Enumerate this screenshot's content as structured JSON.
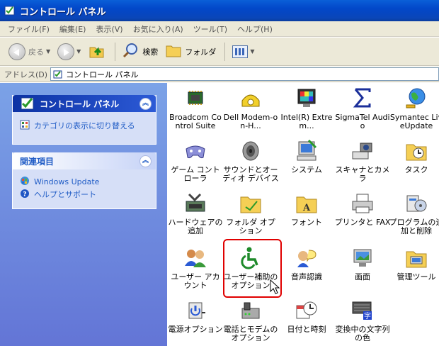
{
  "window": {
    "title": "コントロール パネル"
  },
  "menu": [
    {
      "label": "ファイル(F)"
    },
    {
      "label": "編集(E)"
    },
    {
      "label": "表示(V)"
    },
    {
      "label": "お気に入り(A)"
    },
    {
      "label": "ツール(T)"
    },
    {
      "label": "ヘルプ(H)"
    }
  ],
  "toolbar": {
    "back_label": "戻る",
    "search_label": "検索",
    "folders_label": "フォルダ"
  },
  "address": {
    "label": "アドレス(D)",
    "value": "コントロール パネル"
  },
  "taskpane": {
    "cp_panel": {
      "title": "コントロール パネル",
      "links": [
        {
          "label": "カテゴリの表示に切り替える"
        }
      ]
    },
    "related_panel": {
      "title": "関連項目",
      "links": [
        {
          "label": "Windows Update"
        },
        {
          "label": "ヘルプとサポート"
        }
      ]
    }
  },
  "items": [
    {
      "label": "Broadcom Control Suite",
      "icon": "chip-icon"
    },
    {
      "label": "Dell Modem-on-H...",
      "icon": "phone-icon"
    },
    {
      "label": "Intel(R) Extrem...",
      "icon": "monitor-icon"
    },
    {
      "label": "SigmaTel Audio",
      "icon": "sigma-icon"
    },
    {
      "label": "Symantec LiveUpdate",
      "icon": "globe-icon"
    },
    {
      "label": "ゲーム コントローラ",
      "icon": "gamepad-icon"
    },
    {
      "label": "サウンドとオーディオ デバイス",
      "icon": "speaker-icon"
    },
    {
      "label": "システム",
      "icon": "computer-icon"
    },
    {
      "label": "スキャナとカメラ",
      "icon": "camera-icon"
    },
    {
      "label": "タスク",
      "icon": "task-icon"
    },
    {
      "label": "ハードウェアの追加",
      "icon": "hardware-icon"
    },
    {
      "label": "フォルダ オプション",
      "icon": "folder-icon"
    },
    {
      "label": "フォント",
      "icon": "font-folder-icon"
    },
    {
      "label": "プリンタと FAX",
      "icon": "printer-icon"
    },
    {
      "label": "プログラムの追加と削除",
      "icon": "programs-icon"
    },
    {
      "label": "ユーザー アカウント",
      "icon": "users-icon"
    },
    {
      "label": "ユーザー補助のオプション",
      "icon": "accessibility-icon"
    },
    {
      "label": "音声認識",
      "icon": "speech-icon"
    },
    {
      "label": "画面",
      "icon": "display-icon"
    },
    {
      "label": "管理ツール",
      "icon": "admin-tools-icon"
    },
    {
      "label": "電源オプション",
      "icon": "power-icon"
    },
    {
      "label": "電話とモデムのオプション",
      "icon": "modem-icon"
    },
    {
      "label": "日付と時刻",
      "icon": "clock-icon"
    },
    {
      "label": "変換中の文字列の色",
      "icon": "ime-icon"
    }
  ]
}
